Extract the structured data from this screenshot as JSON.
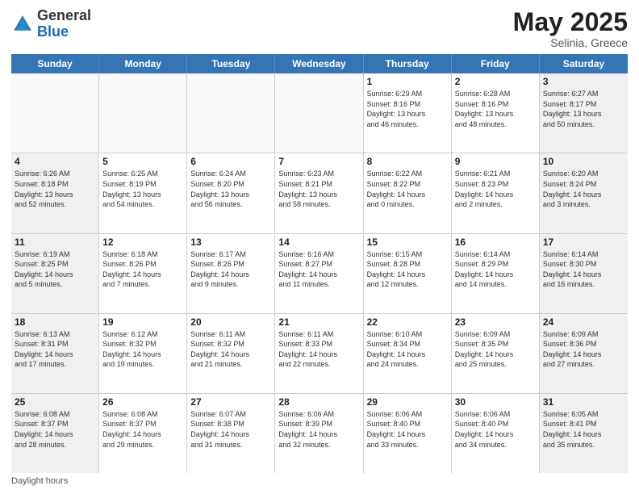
{
  "header": {
    "logo_general": "General",
    "logo_blue": "Blue",
    "title": "May 2025",
    "location": "Selinia, Greece"
  },
  "days_of_week": [
    "Sunday",
    "Monday",
    "Tuesday",
    "Wednesday",
    "Thursday",
    "Friday",
    "Saturday"
  ],
  "weeks": [
    [
      {
        "day": "",
        "info": "",
        "empty": true
      },
      {
        "day": "",
        "info": "",
        "empty": true
      },
      {
        "day": "",
        "info": "",
        "empty": true
      },
      {
        "day": "",
        "info": "",
        "empty": true
      },
      {
        "day": "1",
        "info": "Sunrise: 6:29 AM\nSunset: 8:16 PM\nDaylight: 13 hours\nand 46 minutes.",
        "empty": false
      },
      {
        "day": "2",
        "info": "Sunrise: 6:28 AM\nSunset: 8:16 PM\nDaylight: 13 hours\nand 48 minutes.",
        "empty": false
      },
      {
        "day": "3",
        "info": "Sunrise: 6:27 AM\nSunset: 8:17 PM\nDaylight: 13 hours\nand 50 minutes.",
        "empty": false
      }
    ],
    [
      {
        "day": "4",
        "info": "Sunrise: 6:26 AM\nSunset: 8:18 PM\nDaylight: 13 hours\nand 52 minutes.",
        "empty": false
      },
      {
        "day": "5",
        "info": "Sunrise: 6:25 AM\nSunset: 8:19 PM\nDaylight: 13 hours\nand 54 minutes.",
        "empty": false
      },
      {
        "day": "6",
        "info": "Sunrise: 6:24 AM\nSunset: 8:20 PM\nDaylight: 13 hours\nand 56 minutes.",
        "empty": false
      },
      {
        "day": "7",
        "info": "Sunrise: 6:23 AM\nSunset: 8:21 PM\nDaylight: 13 hours\nand 58 minutes.",
        "empty": false
      },
      {
        "day": "8",
        "info": "Sunrise: 6:22 AM\nSunset: 8:22 PM\nDaylight: 14 hours\nand 0 minutes.",
        "empty": false
      },
      {
        "day": "9",
        "info": "Sunrise: 6:21 AM\nSunset: 8:23 PM\nDaylight: 14 hours\nand 2 minutes.",
        "empty": false
      },
      {
        "day": "10",
        "info": "Sunrise: 6:20 AM\nSunset: 8:24 PM\nDaylight: 14 hours\nand 3 minutes.",
        "empty": false
      }
    ],
    [
      {
        "day": "11",
        "info": "Sunrise: 6:19 AM\nSunset: 8:25 PM\nDaylight: 14 hours\nand 5 minutes.",
        "empty": false
      },
      {
        "day": "12",
        "info": "Sunrise: 6:18 AM\nSunset: 8:26 PM\nDaylight: 14 hours\nand 7 minutes.",
        "empty": false
      },
      {
        "day": "13",
        "info": "Sunrise: 6:17 AM\nSunset: 8:26 PM\nDaylight: 14 hours\nand 9 minutes.",
        "empty": false
      },
      {
        "day": "14",
        "info": "Sunrise: 6:16 AM\nSunset: 8:27 PM\nDaylight: 14 hours\nand 11 minutes.",
        "empty": false
      },
      {
        "day": "15",
        "info": "Sunrise: 6:15 AM\nSunset: 8:28 PM\nDaylight: 14 hours\nand 12 minutes.",
        "empty": false
      },
      {
        "day": "16",
        "info": "Sunrise: 6:14 AM\nSunset: 8:29 PM\nDaylight: 14 hours\nand 14 minutes.",
        "empty": false
      },
      {
        "day": "17",
        "info": "Sunrise: 6:14 AM\nSunset: 8:30 PM\nDaylight: 14 hours\nand 16 minutes.",
        "empty": false
      }
    ],
    [
      {
        "day": "18",
        "info": "Sunrise: 6:13 AM\nSunset: 8:31 PM\nDaylight: 14 hours\nand 17 minutes.",
        "empty": false
      },
      {
        "day": "19",
        "info": "Sunrise: 6:12 AM\nSunset: 8:32 PM\nDaylight: 14 hours\nand 19 minutes.",
        "empty": false
      },
      {
        "day": "20",
        "info": "Sunrise: 6:11 AM\nSunset: 8:32 PM\nDaylight: 14 hours\nand 21 minutes.",
        "empty": false
      },
      {
        "day": "21",
        "info": "Sunrise: 6:11 AM\nSunset: 8:33 PM\nDaylight: 14 hours\nand 22 minutes.",
        "empty": false
      },
      {
        "day": "22",
        "info": "Sunrise: 6:10 AM\nSunset: 8:34 PM\nDaylight: 14 hours\nand 24 minutes.",
        "empty": false
      },
      {
        "day": "23",
        "info": "Sunrise: 6:09 AM\nSunset: 8:35 PM\nDaylight: 14 hours\nand 25 minutes.",
        "empty": false
      },
      {
        "day": "24",
        "info": "Sunrise: 6:09 AM\nSunset: 8:36 PM\nDaylight: 14 hours\nand 27 minutes.",
        "empty": false
      }
    ],
    [
      {
        "day": "25",
        "info": "Sunrise: 6:08 AM\nSunset: 8:37 PM\nDaylight: 14 hours\nand 28 minutes.",
        "empty": false
      },
      {
        "day": "26",
        "info": "Sunrise: 6:08 AM\nSunset: 8:37 PM\nDaylight: 14 hours\nand 29 minutes.",
        "empty": false
      },
      {
        "day": "27",
        "info": "Sunrise: 6:07 AM\nSunset: 8:38 PM\nDaylight: 14 hours\nand 31 minutes.",
        "empty": false
      },
      {
        "day": "28",
        "info": "Sunrise: 6:06 AM\nSunset: 8:39 PM\nDaylight: 14 hours\nand 32 minutes.",
        "empty": false
      },
      {
        "day": "29",
        "info": "Sunrise: 6:06 AM\nSunset: 8:40 PM\nDaylight: 14 hours\nand 33 minutes.",
        "empty": false
      },
      {
        "day": "30",
        "info": "Sunrise: 6:06 AM\nSunset: 8:40 PM\nDaylight: 14 hours\nand 34 minutes.",
        "empty": false
      },
      {
        "day": "31",
        "info": "Sunrise: 6:05 AM\nSunset: 8:41 PM\nDaylight: 14 hours\nand 35 minutes.",
        "empty": false
      }
    ]
  ],
  "footer": {
    "daylight_label": "Daylight hours"
  },
  "colors": {
    "header_bg": "#3375b5",
    "header_text": "#ffffff",
    "accent_blue": "#1a6bbf"
  }
}
